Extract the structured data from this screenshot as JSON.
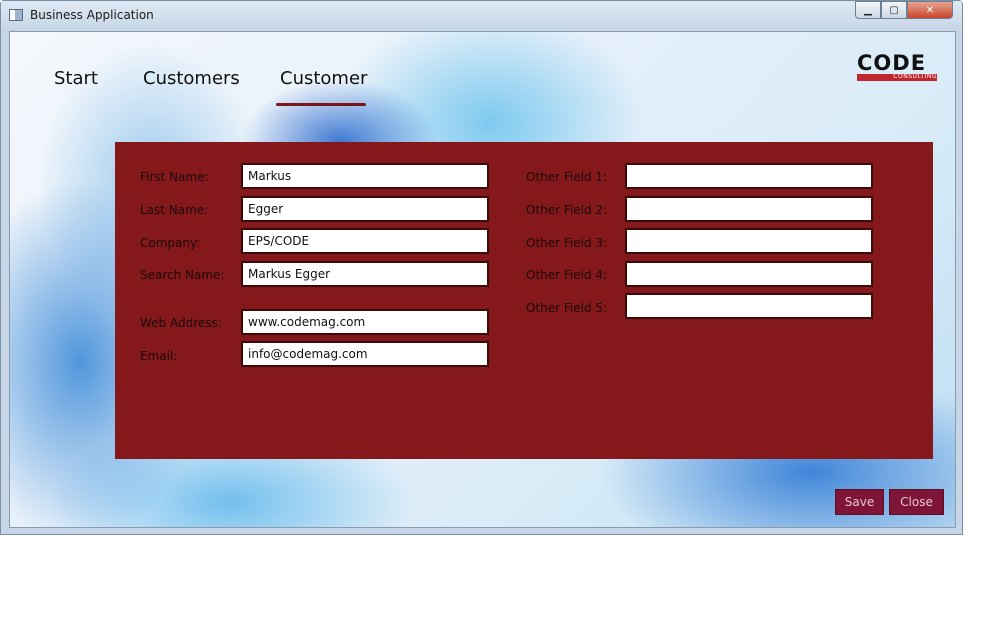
{
  "window": {
    "title": "Business Application"
  },
  "nav": {
    "tabs": [
      "Start",
      "Customers",
      "Customer"
    ],
    "active": "Customer"
  },
  "logo": {
    "word": "CODE",
    "sub": "CONSULTING"
  },
  "form": {
    "left": [
      {
        "label": "First Name:",
        "value": "Markus"
      },
      {
        "label": "Last Name:",
        "value": "Egger"
      },
      {
        "label": "Company:",
        "value": "EPS/CODE"
      },
      {
        "label": "Search Name:",
        "value": "Markus Egger"
      },
      {
        "label": "Web Address:",
        "value": "www.codemag.com"
      },
      {
        "label": "Email:",
        "value": "info@codemag.com"
      }
    ],
    "right": [
      {
        "label": "Other Field 1:",
        "value": ""
      },
      {
        "label": "Other Field 2:",
        "value": ""
      },
      {
        "label": "Other Field 3:",
        "value": ""
      },
      {
        "label": "Other Field 4:",
        "value": ""
      },
      {
        "label": "Other Field 5:",
        "value": ""
      }
    ]
  },
  "buttons": {
    "save": "Save",
    "close": "Close"
  },
  "colors": {
    "panel": "#84181a",
    "accent": "#7a1518",
    "button": "#7e1536"
  }
}
